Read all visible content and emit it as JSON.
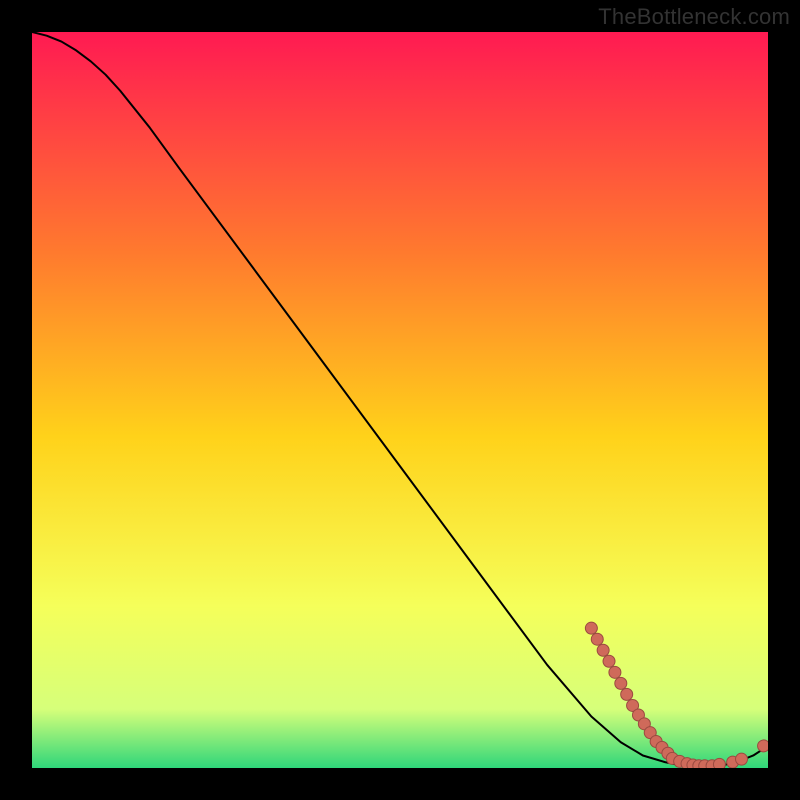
{
  "watermark": "TheBottleneck.com",
  "colors": {
    "background": "#000000",
    "gradient_top": "#ff1a52",
    "gradient_upper_mid": "#ff7a2e",
    "gradient_mid": "#ffd21a",
    "gradient_lower_mid": "#f5ff5a",
    "gradient_low": "#d6ff7a",
    "gradient_bottom": "#2fd67a",
    "curve": "#000000",
    "marker_fill": "#cf6a5a",
    "marker_stroke": "#9a4a40"
  },
  "chart_data": {
    "type": "line",
    "title": "",
    "xlabel": "",
    "ylabel": "",
    "xlim": [
      0,
      100
    ],
    "ylim": [
      0,
      100
    ],
    "grid": false,
    "legend": false,
    "series": [
      {
        "name": "curve",
        "x": [
          0,
          2,
          4,
          6,
          8,
          10,
          12,
          16,
          20,
          30,
          40,
          50,
          60,
          70,
          76,
          80,
          83,
          86,
          88,
          90,
          92,
          94,
          96,
          98,
          100
        ],
        "y": [
          100,
          99.5,
          98.7,
          97.5,
          96,
          94.2,
          92,
          87,
          81.5,
          68,
          54.5,
          41,
          27.5,
          14,
          7,
          3.5,
          1.7,
          0.8,
          0.4,
          0.2,
          0.2,
          0.4,
          0.9,
          1.7,
          3
        ]
      }
    ],
    "markers": [
      {
        "x": 76,
        "y": 19
      },
      {
        "x": 76.8,
        "y": 17.5
      },
      {
        "x": 77.6,
        "y": 16
      },
      {
        "x": 78.4,
        "y": 14.5
      },
      {
        "x": 79.2,
        "y": 13
      },
      {
        "x": 80,
        "y": 11.5
      },
      {
        "x": 80.8,
        "y": 10
      },
      {
        "x": 81.6,
        "y": 8.5
      },
      {
        "x": 82.4,
        "y": 7.2
      },
      {
        "x": 83.2,
        "y": 6
      },
      {
        "x": 84,
        "y": 4.8
      },
      {
        "x": 84.8,
        "y": 3.6
      },
      {
        "x": 85.6,
        "y": 2.8
      },
      {
        "x": 86.4,
        "y": 2
      },
      {
        "x": 87,
        "y": 1.3
      },
      {
        "x": 88,
        "y": 0.9
      },
      {
        "x": 89,
        "y": 0.6
      },
      {
        "x": 89.8,
        "y": 0.4
      },
      {
        "x": 90.6,
        "y": 0.3
      },
      {
        "x": 91.4,
        "y": 0.3
      },
      {
        "x": 92.4,
        "y": 0.3
      },
      {
        "x": 93.4,
        "y": 0.5
      },
      {
        "x": 95.2,
        "y": 0.8
      },
      {
        "x": 96.4,
        "y": 1.2
      },
      {
        "x": 99.4,
        "y": 3
      }
    ]
  }
}
